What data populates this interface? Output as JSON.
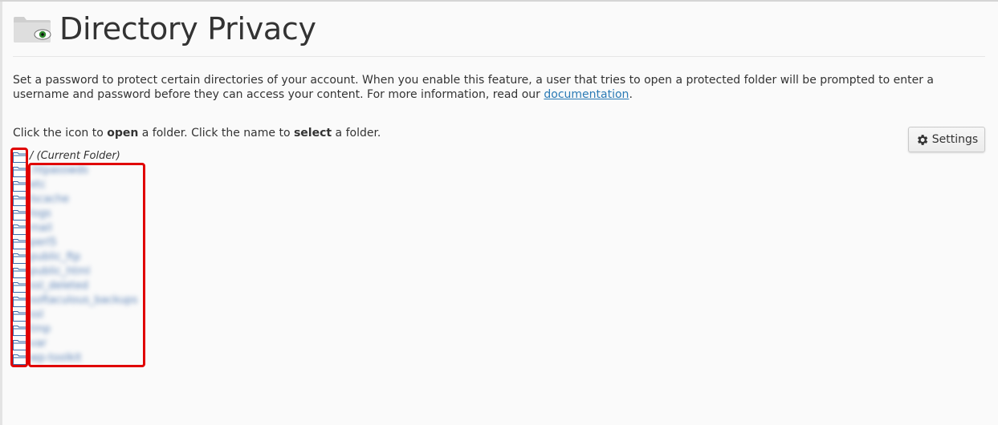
{
  "page": {
    "title": "Directory Privacy",
    "header_icon": "folder-eye-icon"
  },
  "intro": {
    "text_before_link": "Set a password to protect certain directories of your account. When you enable this feature, a user that tries to open a protected folder will be prompted to enter a username and password before they can access your content. For more information, read our ",
    "link_label": "documentation",
    "text_after_link": "."
  },
  "instruction": {
    "part1": "Click the icon to ",
    "bold1": "open",
    "part2": " a folder. Click the name to ",
    "bold2": "select",
    "part3": " a folder."
  },
  "settings": {
    "label": "Settings",
    "icon": "gear-icon"
  },
  "tree": {
    "folder_icon": "folder-icon",
    "current_folder_label": "/ (Current Folder)",
    "folders": [
      {
        "label": ".htpasswds"
      },
      {
        "label": "etc"
      },
      {
        "label": "lscache"
      },
      {
        "label": "logs"
      },
      {
        "label": "mail"
      },
      {
        "label": "perl5"
      },
      {
        "label": "public_ftp"
      },
      {
        "label": "public_html"
      },
      {
        "label": "ssl_deleted"
      },
      {
        "label": "softaculous_backups"
      },
      {
        "label": "ssl"
      },
      {
        "label": "tmp"
      },
      {
        "label": "var"
      },
      {
        "label": "wp-toolkit"
      }
    ]
  },
  "colors": {
    "annotation": "#e00000",
    "link": "#2a7ab5"
  }
}
